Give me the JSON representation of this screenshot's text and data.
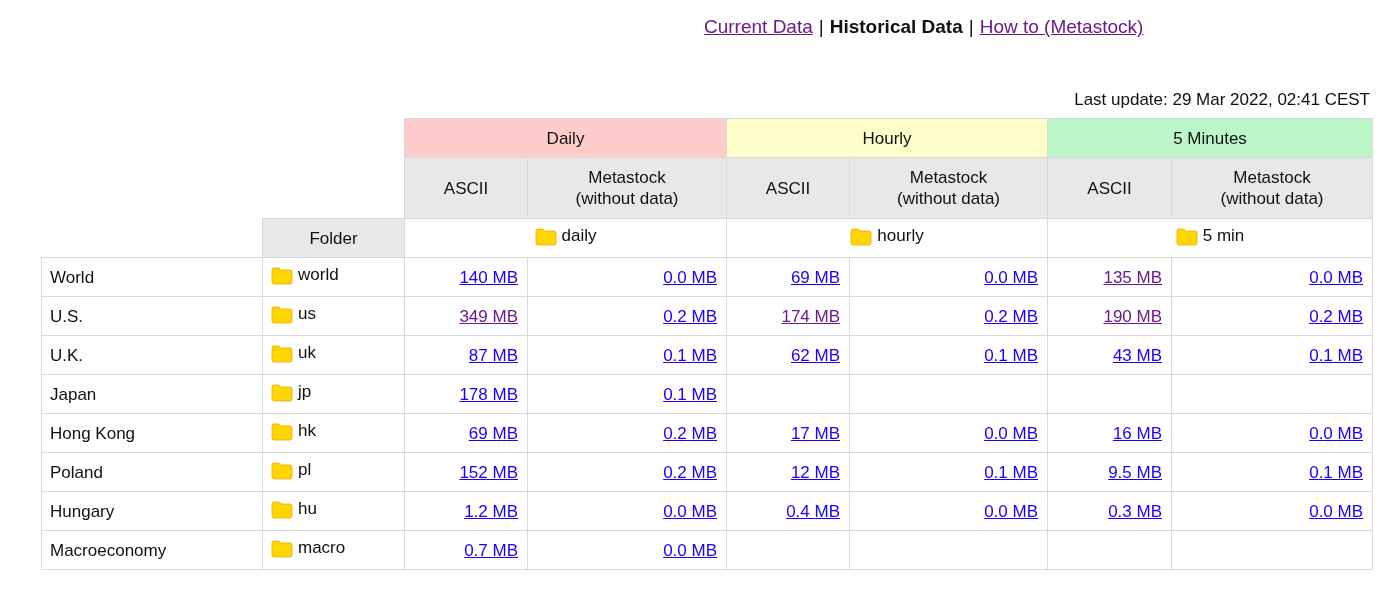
{
  "nav": [
    {
      "kind": "link",
      "label": "Current Data",
      "visited": true
    },
    {
      "kind": "separator",
      "label": "|"
    },
    {
      "kind": "current",
      "label": "Historical Data"
    },
    {
      "kind": "separator",
      "label": "|"
    },
    {
      "kind": "link",
      "label": "How to (Metastock)",
      "visited": true
    }
  ],
  "last_update": "Last update: 29 Mar 2022, 02:41 CEST",
  "groups": [
    {
      "title": "Daily",
      "color": "#ffcccc",
      "folder": "daily"
    },
    {
      "title": "Hourly",
      "color": "#ffffcc",
      "folder": "hourly"
    },
    {
      "title": "5 Minutes",
      "color": "#bbf7c8",
      "folder": "5 min"
    }
  ],
  "subheaders": [
    "ASCII",
    "Metastock\n(without data)",
    "ASCII",
    "Metastock\n(without data)",
    "ASCII",
    "Metastock\n(without data)"
  ],
  "folder_header": "Folder",
  "rows": [
    {
      "name": "World",
      "folder": "world",
      "cells": [
        {
          "text": "140 MB",
          "visited": false
        },
        {
          "text": "0.0 MB",
          "visited": false
        },
        {
          "text": "69 MB",
          "visited": false
        },
        {
          "text": "0.0 MB",
          "visited": false
        },
        {
          "text": "135 MB",
          "visited": true
        },
        {
          "text": "0.0 MB",
          "visited": false
        }
      ]
    },
    {
      "name": "U.S.",
      "folder": "us",
      "cells": [
        {
          "text": "349 MB",
          "visited": true
        },
        {
          "text": "0.2 MB",
          "visited": false
        },
        {
          "text": "174 MB",
          "visited": true
        },
        {
          "text": "0.2 MB",
          "visited": false
        },
        {
          "text": "190 MB",
          "visited": true
        },
        {
          "text": "0.2 MB",
          "visited": false
        }
      ]
    },
    {
      "name": "U.K.",
      "folder": "uk",
      "cells": [
        {
          "text": "87 MB",
          "visited": false
        },
        {
          "text": "0.1 MB",
          "visited": false
        },
        {
          "text": "62 MB",
          "visited": false
        },
        {
          "text": "0.1 MB",
          "visited": false
        },
        {
          "text": "43 MB",
          "visited": false
        },
        {
          "text": "0.1 MB",
          "visited": false
        }
      ]
    },
    {
      "name": "Japan",
      "folder": "jp",
      "cells": [
        {
          "text": "178 MB",
          "visited": false
        },
        {
          "text": "0.1 MB",
          "visited": false
        },
        null,
        null,
        null,
        null
      ]
    },
    {
      "name": "Hong Kong",
      "folder": "hk",
      "cells": [
        {
          "text": "69 MB",
          "visited": false
        },
        {
          "text": "0.2 MB",
          "visited": false
        },
        {
          "text": "17 MB",
          "visited": false
        },
        {
          "text": "0.0 MB",
          "visited": false
        },
        {
          "text": "16 MB",
          "visited": false
        },
        {
          "text": "0.0 MB",
          "visited": false
        }
      ]
    },
    {
      "name": "Poland",
      "folder": "pl",
      "cells": [
        {
          "text": "152 MB",
          "visited": false
        },
        {
          "text": "0.2 MB",
          "visited": false
        },
        {
          "text": "12 MB",
          "visited": false
        },
        {
          "text": "0.1 MB",
          "visited": false
        },
        {
          "text": "9.5 MB",
          "visited": false
        },
        {
          "text": "0.1 MB",
          "visited": false
        }
      ]
    },
    {
      "name": "Hungary",
      "folder": "hu",
      "cells": [
        {
          "text": "1.2 MB",
          "visited": false
        },
        {
          "text": "0.0 MB",
          "visited": false
        },
        {
          "text": "0.4 MB",
          "visited": false
        },
        {
          "text": "0.0 MB",
          "visited": false
        },
        {
          "text": "0.3 MB",
          "visited": false
        },
        {
          "text": "0.0 MB",
          "visited": false
        }
      ]
    },
    {
      "name": "Macroeconomy",
      "folder": "macro",
      "cells": [
        {
          "text": "0.7 MB",
          "visited": false
        },
        {
          "text": "0.0 MB",
          "visited": false
        },
        null,
        null,
        null,
        null
      ]
    }
  ]
}
